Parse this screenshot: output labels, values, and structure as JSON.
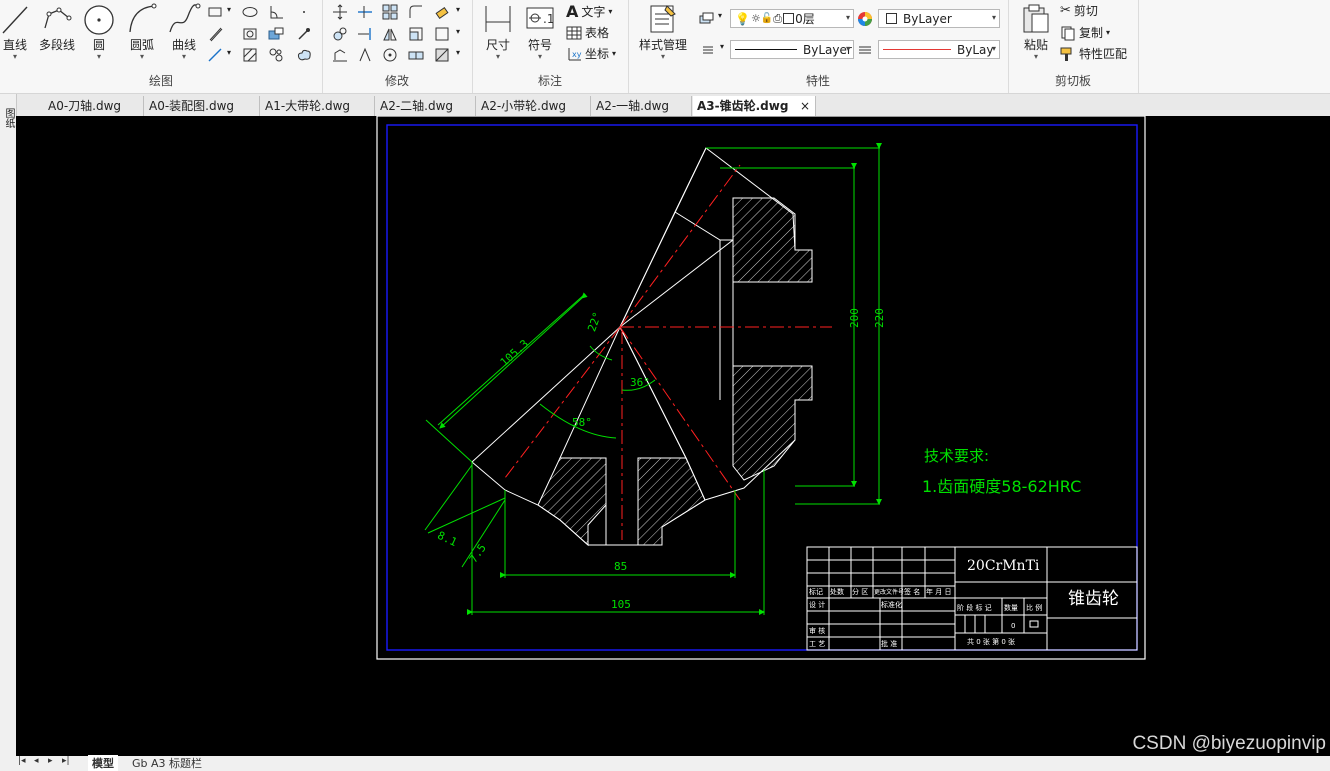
{
  "ribbon": {
    "draw": {
      "title": "绘图",
      "line": "直线",
      "polyline": "多段线",
      "circle": "圆",
      "arc": "圆弧",
      "curve": "曲线"
    },
    "modify": {
      "title": "修改"
    },
    "annotate": {
      "title": "标注",
      "dimension": "尺寸",
      "symbol": "符号",
      "text": "文字",
      "table": "表格",
      "coordinate": "坐标"
    },
    "properties": {
      "title": "特性",
      "style_manager": "样式管理",
      "layer_value": "0层",
      "color_value": "ByLayer",
      "linetype_value": "ByLayer",
      "lineweight_value": "ByLay"
    },
    "clipboard": {
      "title": "剪切板",
      "paste": "粘贴",
      "cut": "剪切",
      "copy": "复制",
      "match": "特性匹配"
    }
  },
  "tabs": [
    {
      "label": "A0-刀轴.dwg"
    },
    {
      "label": "A0-装配图.dwg"
    },
    {
      "label": "A1-大带轮.dwg"
    },
    {
      "label": "A2-二轴.dwg"
    },
    {
      "label": "A2-小带轮.dwg"
    },
    {
      "label": "A2-一轴.dwg"
    },
    {
      "label": "A3-锥齿轮.dwg",
      "active": true
    }
  ],
  "tab_close": "×",
  "left_strip_label": "图纸",
  "drawing": {
    "dims": {
      "d200": "200",
      "d220": "220",
      "d105_3": "105.3",
      "a22": "22°",
      "a36": "36°",
      "a58": "58°",
      "d8_1": "8.1",
      "d7_5": "7.5",
      "d85": "85",
      "d105": "105"
    },
    "tech_title": "技术要求:",
    "tech_item": "1.齿面硬度58-62HRC",
    "title_block": {
      "material": "20CrMnTi",
      "part_name": "锥齿轮",
      "row_labels": [
        "标记",
        "处数",
        "分 区",
        "更改文件号",
        "签 名",
        "年 月 日"
      ],
      "design": "设 计",
      "standard": "标准化",
      "stage_labels": [
        "阶 段 标 记",
        "数量",
        "比 例"
      ],
      "review": "审 核",
      "process": "工 艺",
      "approve": "批 准",
      "qty": "0",
      "sheets": "共  0  张  第  0  张"
    }
  },
  "bottom": {
    "model_tab": "模型",
    "layout_tab": "Gb A3 标题栏"
  },
  "watermark": "CSDN @biyezuopinvip",
  "colors": {
    "canvas": "#000000",
    "geometry": "#ffffff",
    "dimension": "#00e000",
    "centerline": "#ff2020",
    "frame": "#1a1aff"
  }
}
